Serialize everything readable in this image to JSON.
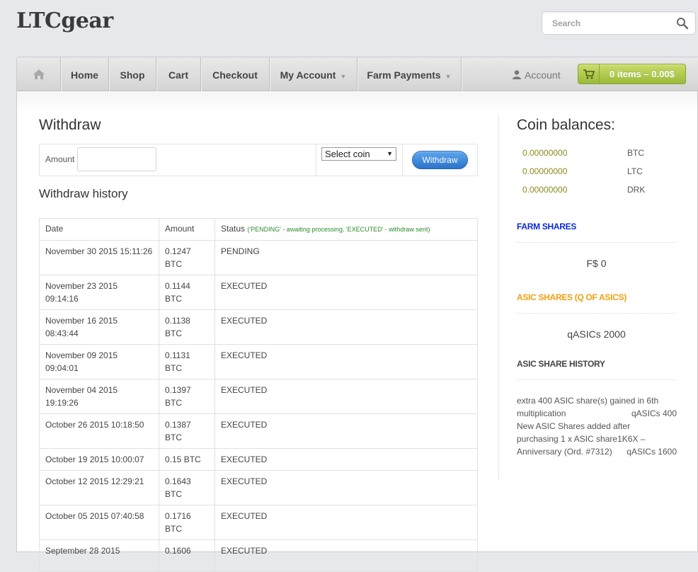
{
  "header": {
    "logo": "LTCgear",
    "search_placeholder": "Search"
  },
  "nav": {
    "items": [
      {
        "label": "Home"
      },
      {
        "label": "Shop"
      },
      {
        "label": "Cart"
      },
      {
        "label": "Checkout"
      },
      {
        "label": "My Account",
        "has_dropdown": true
      },
      {
        "label": "Farm Payments",
        "has_dropdown": true
      }
    ],
    "account_label": "Account",
    "cart_label": "0 items – 0.00$"
  },
  "withdraw": {
    "title": "Withdraw",
    "amount_label": "Amount",
    "amount_value": "",
    "coin_select_value": "Select coin",
    "button_label": "Withdraw"
  },
  "history": {
    "title": "Withdraw history",
    "columns": {
      "date": "Date",
      "amount": "Amount",
      "status": "Status",
      "status_note": "('PENDING' - awaiting processing, 'EXECUTED' - withdraw sent)"
    },
    "rows": [
      {
        "date": "November 30 2015 15:11:26",
        "amount": "0.1247 BTC",
        "status": "PENDING"
      },
      {
        "date": "November 23 2015 09:14:16",
        "amount": "0.1144 BTC",
        "status": "EXECUTED"
      },
      {
        "date": "November 16 2015 08:43:44",
        "amount": "0.1138 BTC",
        "status": "EXECUTED"
      },
      {
        "date": "November 09 2015 09:04:01",
        "amount": "0.1131 BTC",
        "status": "EXECUTED"
      },
      {
        "date": "November 04 2015 19:19:26",
        "amount": "0.1397 BTC",
        "status": "EXECUTED"
      },
      {
        "date": "October 26 2015 10:18:50",
        "amount": "0.1387 BTC",
        "status": "EXECUTED"
      },
      {
        "date": "October 19 2015 10:00:07",
        "amount": "0.15 BTC",
        "status": "EXECUTED"
      },
      {
        "date": "October 12 2015 12:29:21",
        "amount": "0.1643 BTC",
        "status": "EXECUTED"
      },
      {
        "date": "October 05 2015 07:40:58",
        "amount": "0.1716 BTC",
        "status": "EXECUTED"
      },
      {
        "date": "September 28 2015",
        "amount": "0.1606",
        "status": "EXECUTED"
      }
    ]
  },
  "sidebar": {
    "balances_title": "Coin balances:",
    "balances": [
      {
        "value": "0.00000000",
        "coin": "BTC"
      },
      {
        "value": "0.00000000",
        "coin": "LTC"
      },
      {
        "value": "0.00000000",
        "coin": "DRK"
      }
    ],
    "farm_shares_title": "FARM SHARES",
    "farm_shares_value": "F$ 0",
    "asic_shares_title": "ASIC SHARES (Q OF ASICS)",
    "asic_shares_value": "qASICs 2000",
    "asic_history_title": "ASIC SHARE HISTORY",
    "asic_history": [
      {
        "line1": "extra 400 ASIC share(s) gained in 6th",
        "line2": "multiplication",
        "amount": "qASICs 400"
      },
      {
        "line1": "New ASIC Shares added after",
        "line2": "purchasing 1 x ASIC share1K6X –",
        "line3": "Anniversary (Ord. #7312)",
        "amount": "qASICs 1600"
      }
    ]
  },
  "colors": {
    "link_blue": "#0a2bd6",
    "asic_orange": "#f0a010",
    "balance_olive": "#8a8a1e",
    "cart_green": "#9ab93a",
    "button_blue": "#2b73cb"
  }
}
